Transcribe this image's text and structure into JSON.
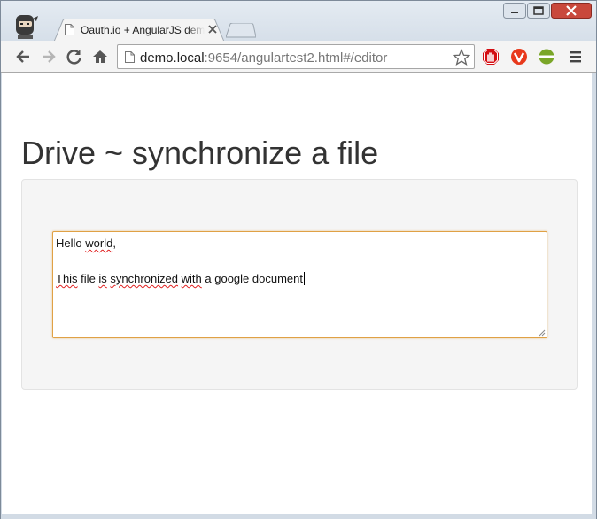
{
  "browser": {
    "tab_title": "Oauth.io + AngularJS demo",
    "address": {
      "host": "demo.local",
      "path": ":9654/angulartest2.html#/editor"
    }
  },
  "page": {
    "heading": "Drive ~ synchronize a file",
    "editor": {
      "line1_word1": "Hello",
      "line1_word2": "world",
      "line1_tail": ",",
      "line2_word1": "This",
      "line2_sp1": " file ",
      "line2_word2": "is",
      "line2_sp2": " ",
      "line2_word3": "synchronized",
      "line2_sp3": " ",
      "line2_word4": "with",
      "line2_tail": " a google document"
    }
  },
  "colors": {
    "editor_focus_border": "#e0a145",
    "well_background": "#f5f5f5"
  },
  "icons": [
    "profile-avatar-icon",
    "page-icon",
    "close-icon",
    "back-icon",
    "forward-icon",
    "reload-icon",
    "home-icon",
    "star-icon",
    "adblock-icon",
    "vivaldi-ext-icon",
    "green-ext-icon",
    "menu-icon"
  ]
}
